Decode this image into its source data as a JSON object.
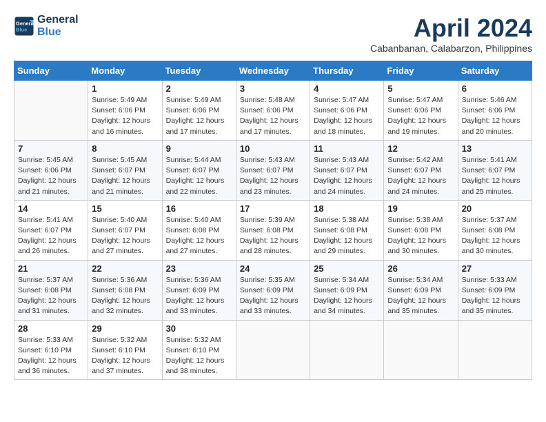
{
  "logo": {
    "line1": "General",
    "line2": "Blue"
  },
  "title": "April 2024",
  "subtitle": "Cabanbanan, Calabarzon, Philippines",
  "days_header": [
    "Sunday",
    "Monday",
    "Tuesday",
    "Wednesday",
    "Thursday",
    "Friday",
    "Saturday"
  ],
  "weeks": [
    [
      {
        "day": "",
        "info": ""
      },
      {
        "day": "1",
        "info": "Sunrise: 5:49 AM\nSunset: 6:06 PM\nDaylight: 12 hours\nand 16 minutes."
      },
      {
        "day": "2",
        "info": "Sunrise: 5:49 AM\nSunset: 6:06 PM\nDaylight: 12 hours\nand 17 minutes."
      },
      {
        "day": "3",
        "info": "Sunrise: 5:48 AM\nSunset: 6:06 PM\nDaylight: 12 hours\nand 17 minutes."
      },
      {
        "day": "4",
        "info": "Sunrise: 5:47 AM\nSunset: 6:06 PM\nDaylight: 12 hours\nand 18 minutes."
      },
      {
        "day": "5",
        "info": "Sunrise: 5:47 AM\nSunset: 6:06 PM\nDaylight: 12 hours\nand 19 minutes."
      },
      {
        "day": "6",
        "info": "Sunrise: 5:46 AM\nSunset: 6:06 PM\nDaylight: 12 hours\nand 20 minutes."
      }
    ],
    [
      {
        "day": "7",
        "info": "Sunrise: 5:45 AM\nSunset: 6:06 PM\nDaylight: 12 hours\nand 21 minutes."
      },
      {
        "day": "8",
        "info": "Sunrise: 5:45 AM\nSunset: 6:07 PM\nDaylight: 12 hours\nand 21 minutes."
      },
      {
        "day": "9",
        "info": "Sunrise: 5:44 AM\nSunset: 6:07 PM\nDaylight: 12 hours\nand 22 minutes."
      },
      {
        "day": "10",
        "info": "Sunrise: 5:43 AM\nSunset: 6:07 PM\nDaylight: 12 hours\nand 23 minutes."
      },
      {
        "day": "11",
        "info": "Sunrise: 5:43 AM\nSunset: 6:07 PM\nDaylight: 12 hours\nand 24 minutes."
      },
      {
        "day": "12",
        "info": "Sunrise: 5:42 AM\nSunset: 6:07 PM\nDaylight: 12 hours\nand 24 minutes."
      },
      {
        "day": "13",
        "info": "Sunrise: 5:41 AM\nSunset: 6:07 PM\nDaylight: 12 hours\nand 25 minutes."
      }
    ],
    [
      {
        "day": "14",
        "info": "Sunrise: 5:41 AM\nSunset: 6:07 PM\nDaylight: 12 hours\nand 26 minutes."
      },
      {
        "day": "15",
        "info": "Sunrise: 5:40 AM\nSunset: 6:07 PM\nDaylight: 12 hours\nand 27 minutes."
      },
      {
        "day": "16",
        "info": "Sunrise: 5:40 AM\nSunset: 6:08 PM\nDaylight: 12 hours\nand 27 minutes."
      },
      {
        "day": "17",
        "info": "Sunrise: 5:39 AM\nSunset: 6:08 PM\nDaylight: 12 hours\nand 28 minutes."
      },
      {
        "day": "18",
        "info": "Sunrise: 5:38 AM\nSunset: 6:08 PM\nDaylight: 12 hours\nand 29 minutes."
      },
      {
        "day": "19",
        "info": "Sunrise: 5:38 AM\nSunset: 6:08 PM\nDaylight: 12 hours\nand 30 minutes."
      },
      {
        "day": "20",
        "info": "Sunrise: 5:37 AM\nSunset: 6:08 PM\nDaylight: 12 hours\nand 30 minutes."
      }
    ],
    [
      {
        "day": "21",
        "info": "Sunrise: 5:37 AM\nSunset: 6:08 PM\nDaylight: 12 hours\nand 31 minutes."
      },
      {
        "day": "22",
        "info": "Sunrise: 5:36 AM\nSunset: 6:08 PM\nDaylight: 12 hours\nand 32 minutes."
      },
      {
        "day": "23",
        "info": "Sunrise: 5:36 AM\nSunset: 6:09 PM\nDaylight: 12 hours\nand 33 minutes."
      },
      {
        "day": "24",
        "info": "Sunrise: 5:35 AM\nSunset: 6:09 PM\nDaylight: 12 hours\nand 33 minutes."
      },
      {
        "day": "25",
        "info": "Sunrise: 5:34 AM\nSunset: 6:09 PM\nDaylight: 12 hours\nand 34 minutes."
      },
      {
        "day": "26",
        "info": "Sunrise: 5:34 AM\nSunset: 6:09 PM\nDaylight: 12 hours\nand 35 minutes."
      },
      {
        "day": "27",
        "info": "Sunrise: 5:33 AM\nSunset: 6:09 PM\nDaylight: 12 hours\nand 35 minutes."
      }
    ],
    [
      {
        "day": "28",
        "info": "Sunrise: 5:33 AM\nSunset: 6:10 PM\nDaylight: 12 hours\nand 36 minutes."
      },
      {
        "day": "29",
        "info": "Sunrise: 5:32 AM\nSunset: 6:10 PM\nDaylight: 12 hours\nand 37 minutes."
      },
      {
        "day": "30",
        "info": "Sunrise: 5:32 AM\nSunset: 6:10 PM\nDaylight: 12 hours\nand 38 minutes."
      },
      {
        "day": "",
        "info": ""
      },
      {
        "day": "",
        "info": ""
      },
      {
        "day": "",
        "info": ""
      },
      {
        "day": "",
        "info": ""
      }
    ]
  ]
}
